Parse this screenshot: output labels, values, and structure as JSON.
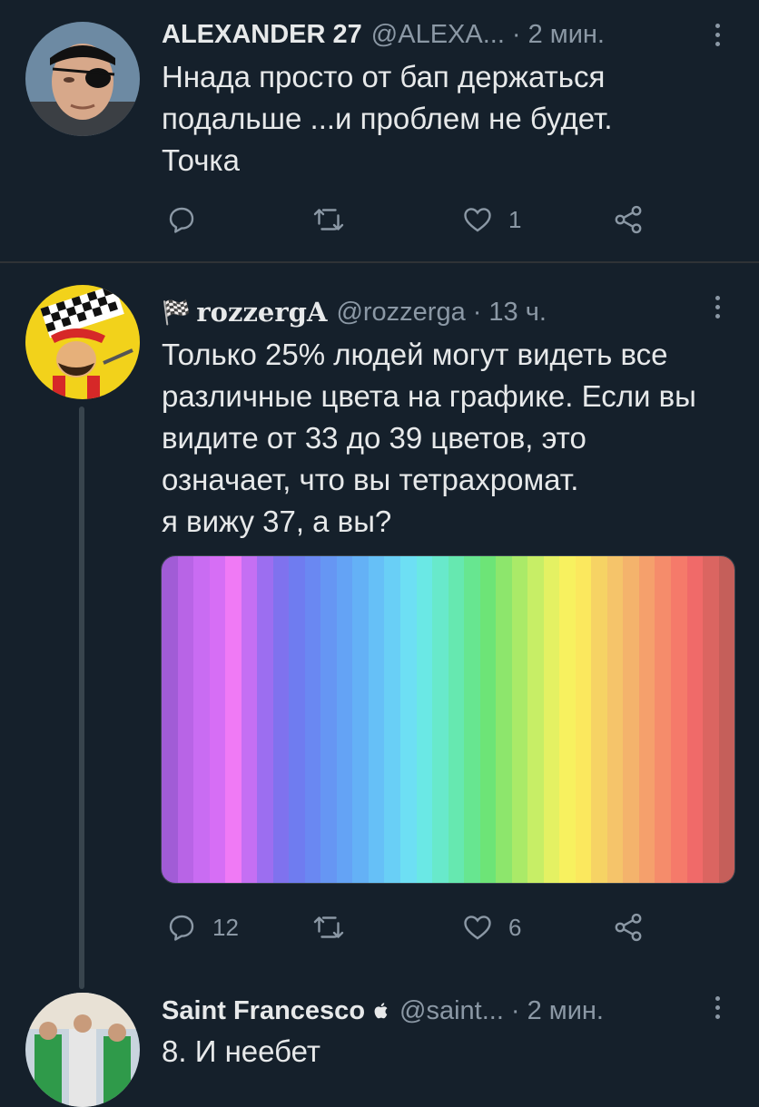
{
  "tweets": [
    {
      "name": "ALEXANDER 27",
      "handle": "@ALEXA...",
      "sep": "·",
      "time": "2 мин.",
      "lines": [
        "Ннада просто от бап держаться",
        "подальше ...и проблем не будет.",
        "Точка"
      ],
      "actions": {
        "reply": "",
        "retweet": "",
        "like": "1",
        "share": ""
      }
    },
    {
      "flag": "🏁",
      "name": "rozzergA",
      "handle": "@rozzerga",
      "sep": "·",
      "time": "13 ч.",
      "lines": [
        "Только 25% людей могут видеть все",
        "различные цвета на графике. Если вы",
        "видите от 33 до 39 цветов, это",
        "означает, что вы тетрахромат.",
        "я вижу 37, а вы?"
      ],
      "actions": {
        "reply": "12",
        "retweet": "",
        "like": "6",
        "share": ""
      }
    },
    {
      "name": "Saint Francesco",
      "verified_glyph": "",
      "handle": "@saint...",
      "sep": "·",
      "time": "2 мин.",
      "lines": [
        "8. И неебет"
      ]
    }
  ],
  "colors": {
    "background": "#15202b",
    "text": "#e7e9ea",
    "muted": "#8b98a5",
    "divider": "#2f3336"
  },
  "spectrum_colors": [
    "#a15cd6",
    "#b864e6",
    "#c96cf2",
    "#d66ef5",
    "#f07af5",
    "#c56ff3",
    "#9c6ef0",
    "#7f72ee",
    "#6f7cf0",
    "#6a88f2",
    "#6696f3",
    "#64a3f5",
    "#64b1f6",
    "#66c0f7",
    "#69cff6",
    "#6ddff4",
    "#6ae8e5",
    "#68e9cb",
    "#66e8b0",
    "#67e690",
    "#6de477",
    "#8de66c",
    "#aaea68",
    "#c7ee66",
    "#e4f163",
    "#f7f15f",
    "#fbe85e",
    "#f6d364",
    "#f5c46a",
    "#f4b36c",
    "#f5a06c",
    "#f58c6b",
    "#f57a6a",
    "#f06a69",
    "#db6561",
    "#c55f5a"
  ]
}
